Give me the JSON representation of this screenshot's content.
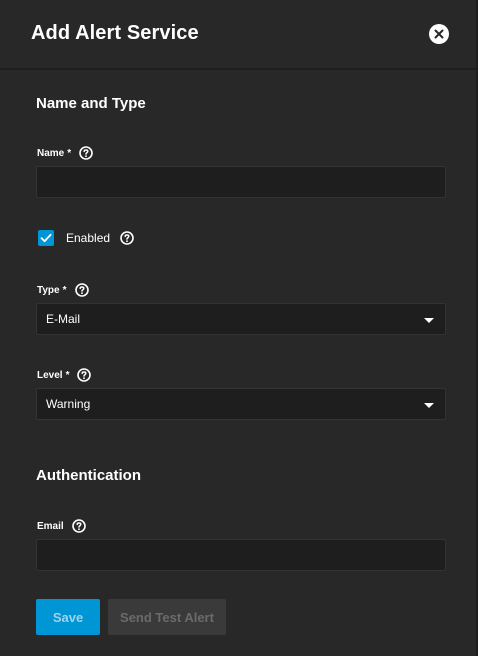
{
  "dialog": {
    "title": "Add Alert Service",
    "close_icon": "close-icon"
  },
  "sections": {
    "name_and_type": "Name and Type",
    "authentication": "Authentication"
  },
  "fields": {
    "name": {
      "label": "Name",
      "required_mark": "*",
      "value": ""
    },
    "enabled": {
      "label": "Enabled",
      "checked": true
    },
    "type": {
      "label": "Type",
      "required_mark": "*",
      "value": "E-Mail"
    },
    "level": {
      "label": "Level",
      "required_mark": "*",
      "value": "Warning"
    },
    "email": {
      "label": "Email",
      "value": ""
    }
  },
  "buttons": {
    "save": "Save",
    "send_test": "Send Test Alert"
  },
  "colors": {
    "background": "#282828",
    "field_bg": "#1e1e1e",
    "accent": "#0095d5",
    "disabled_button": "#3a3a3a"
  }
}
